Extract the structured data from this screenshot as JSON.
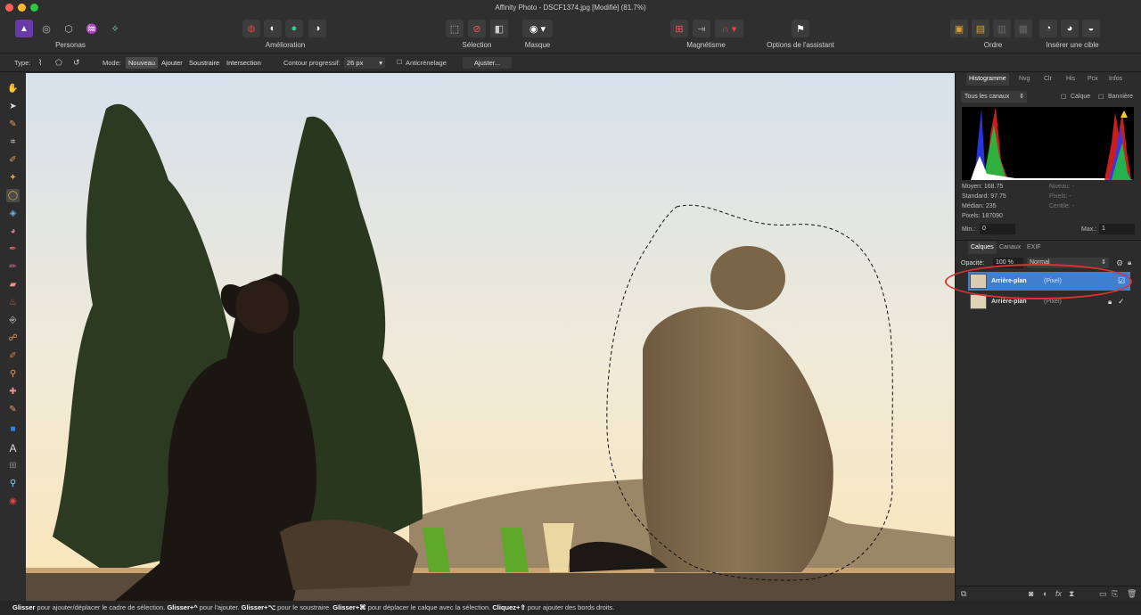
{
  "window": {
    "title": "Affinity Photo - DSCF1374.jpg [Modifié] (81.7%)",
    "traffic_colors": [
      "#fe5f57",
      "#febb2e",
      "#29c840"
    ]
  },
  "toolbar": {
    "personas_label": "Personas",
    "amelioration_label": "Amélioration",
    "selection_label": "Sélection",
    "masque_label": "Masque",
    "magnetisme_label": "Magnétisme",
    "assistant_label": "Options de l'assistant",
    "ordre_label": "Ordre",
    "inserer_label": "Insérer une cible"
  },
  "context": {
    "type_label": "Type:",
    "mode_label": "Mode:",
    "mode_options": [
      "Nouveau",
      "Ajouter",
      "Soustraire",
      "Intersection"
    ],
    "mode_selected": "Nouveau",
    "feather_label": "Contour progressif:",
    "feather_value": "26 px",
    "antialias_label": "Anticrénelage",
    "adjust_label": "Ajuster..."
  },
  "histogram": {
    "tabs": [
      "Histogramme",
      "Nvg",
      "Clr",
      "His",
      "Pcx",
      "Infos"
    ],
    "active_tab": "Histogramme",
    "channel_select": "Tous les canaux",
    "calque_label": "Calque",
    "banniere_label": "Bannière",
    "stats_left": [
      "Moyen: 168.75",
      "Standard: 97.75",
      "Médian: 235",
      "Pixels: 187090"
    ],
    "stats_right": [
      "Niveau: -",
      "Pixels: -",
      "Centile: -"
    ],
    "min_label": "Min.:",
    "min_value": "0",
    "max_label": "Max.:",
    "max_value": "1"
  },
  "layers": {
    "tabs": [
      "Calques",
      "Canaux",
      "EXIF"
    ],
    "active_tab": "Calques",
    "opacity_label": "Opacité:",
    "opacity_value": "100 %",
    "blend_mode": "Normal",
    "items": [
      {
        "name": "Arrière-plan",
        "kind": "(Pixel)",
        "selected": true
      },
      {
        "name": "Arrière-plan",
        "kind": "(Pixel)",
        "selected": false
      }
    ],
    "highlight_color": "#e03030",
    "selected_color": "#3f7fd0"
  },
  "status": {
    "parts": [
      {
        "bold": "Glisser",
        "text": " pour ajouter/déplacer le cadre de sélection. "
      },
      {
        "bold": "Glisser+^",
        "text": " pour l'ajouter. "
      },
      {
        "bold": "Glisser+⌥",
        "text": " pour le soustraire. "
      },
      {
        "bold": "Glisser+⌘",
        "text": " pour déplacer le calque avec la sélection. "
      },
      {
        "bold": "Cliquez+⇧",
        "text": " pour ajouter des bords droits."
      }
    ]
  }
}
